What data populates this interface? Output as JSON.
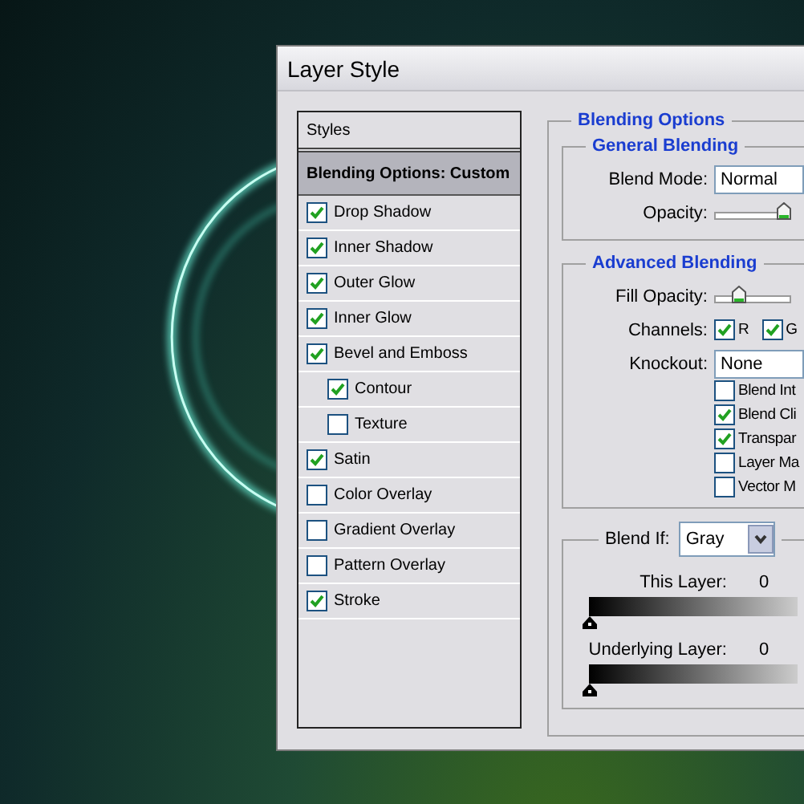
{
  "window": {
    "title": "Layer Style"
  },
  "styles_panel": {
    "header": "Styles",
    "items": [
      {
        "label": "Blending Options: Custom",
        "kind": "option",
        "selected": true
      },
      {
        "label": "Drop Shadow",
        "kind": "effect",
        "checked": true,
        "selected": false
      },
      {
        "label": "Inner Shadow",
        "kind": "effect",
        "checked": true,
        "selected": false
      },
      {
        "label": "Outer Glow",
        "kind": "effect",
        "checked": true,
        "selected": false
      },
      {
        "label": "Inner Glow",
        "kind": "effect",
        "checked": true,
        "selected": false
      },
      {
        "label": "Bevel and Emboss",
        "kind": "effect",
        "checked": true,
        "selected": false
      },
      {
        "label": "Contour",
        "kind": "subeffect",
        "checked": true,
        "selected": false
      },
      {
        "label": "Texture",
        "kind": "subeffect",
        "checked": false,
        "selected": false
      },
      {
        "label": "Satin",
        "kind": "effect",
        "checked": true,
        "selected": false
      },
      {
        "label": "Color Overlay",
        "kind": "effect",
        "checked": false,
        "selected": false
      },
      {
        "label": "Gradient Overlay",
        "kind": "effect",
        "checked": false,
        "selected": false
      },
      {
        "label": "Pattern Overlay",
        "kind": "effect",
        "checked": false,
        "selected": false
      },
      {
        "label": "Stroke",
        "kind": "effect",
        "checked": true,
        "selected": false
      }
    ]
  },
  "blending_options": {
    "title": "Blending Options",
    "general": {
      "title": "General Blending",
      "blend_mode": {
        "label": "Blend Mode:",
        "value": "Normal"
      },
      "opacity": {
        "label": "Opacity:",
        "level": 1
      }
    },
    "advanced": {
      "title": "Advanced Blending",
      "fill_opacity": {
        "label": "Fill Opacity:",
        "level": 0.25
      },
      "channels": {
        "label": "Channels:",
        "items": [
          {
            "label": "R",
            "checked": true
          },
          {
            "label": "G",
            "checked": true
          }
        ]
      },
      "knockout": {
        "label": "Knockout:",
        "value": "None"
      },
      "options": [
        {
          "label": "Blend Int",
          "checked": false
        },
        {
          "label": "Blend Cli",
          "checked": true
        },
        {
          "label": "Transpar",
          "checked": true
        },
        {
          "label": "Layer Ma",
          "checked": false
        },
        {
          "label": "Vector M",
          "checked": false
        }
      ]
    },
    "blend_if": {
      "label": "Blend If:",
      "value": "Gray",
      "this_layer": {
        "label": "This Layer:",
        "value": "0",
        "level": 0
      },
      "underlying_layer": {
        "label": "Underlying Layer:",
        "value": "0",
        "level": 0
      }
    }
  }
}
